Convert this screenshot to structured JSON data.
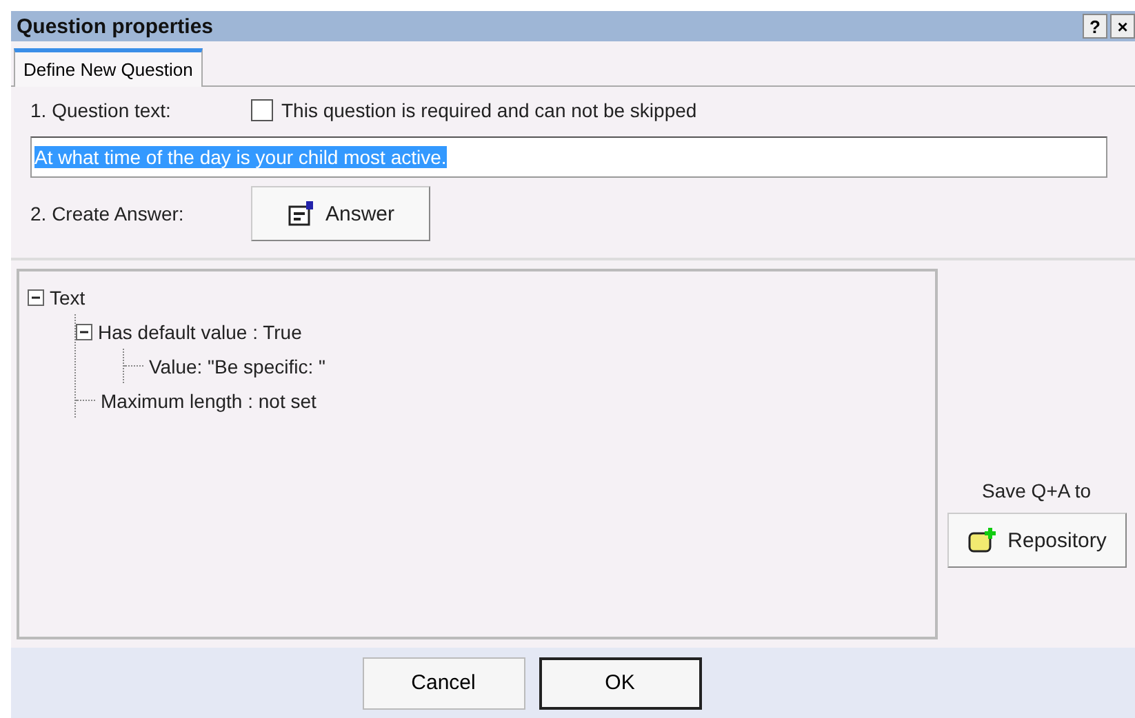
{
  "window": {
    "title": "Question properties",
    "controls": [
      "?",
      "×"
    ]
  },
  "tabs": [
    {
      "label": "Define New Question",
      "selected": true
    }
  ],
  "question_label": "1. Question text:",
  "required_checkbox": {
    "label": "This question is required and can not be skipped",
    "checked": false
  },
  "question_field": {
    "value": "At what time of the day is your child most active.",
    "selected": true
  },
  "answer_label": "2. Create Answer:",
  "answer_button": "Answer",
  "tree": [
    {
      "label": "Text",
      "expanded": true,
      "children": [
        {
          "label": "Has default value : True",
          "expanded": true,
          "children": [
            {
              "label": "Value: \"Be specific:  \""
            }
          ]
        },
        {
          "label": "Maximum length : not set"
        }
      ]
    }
  ],
  "save_label": "Save Q+A to",
  "repository_button": "Repository",
  "buttons": [
    {
      "label": "Cancel",
      "default": false
    },
    {
      "label": "OK",
      "default": true
    }
  ]
}
